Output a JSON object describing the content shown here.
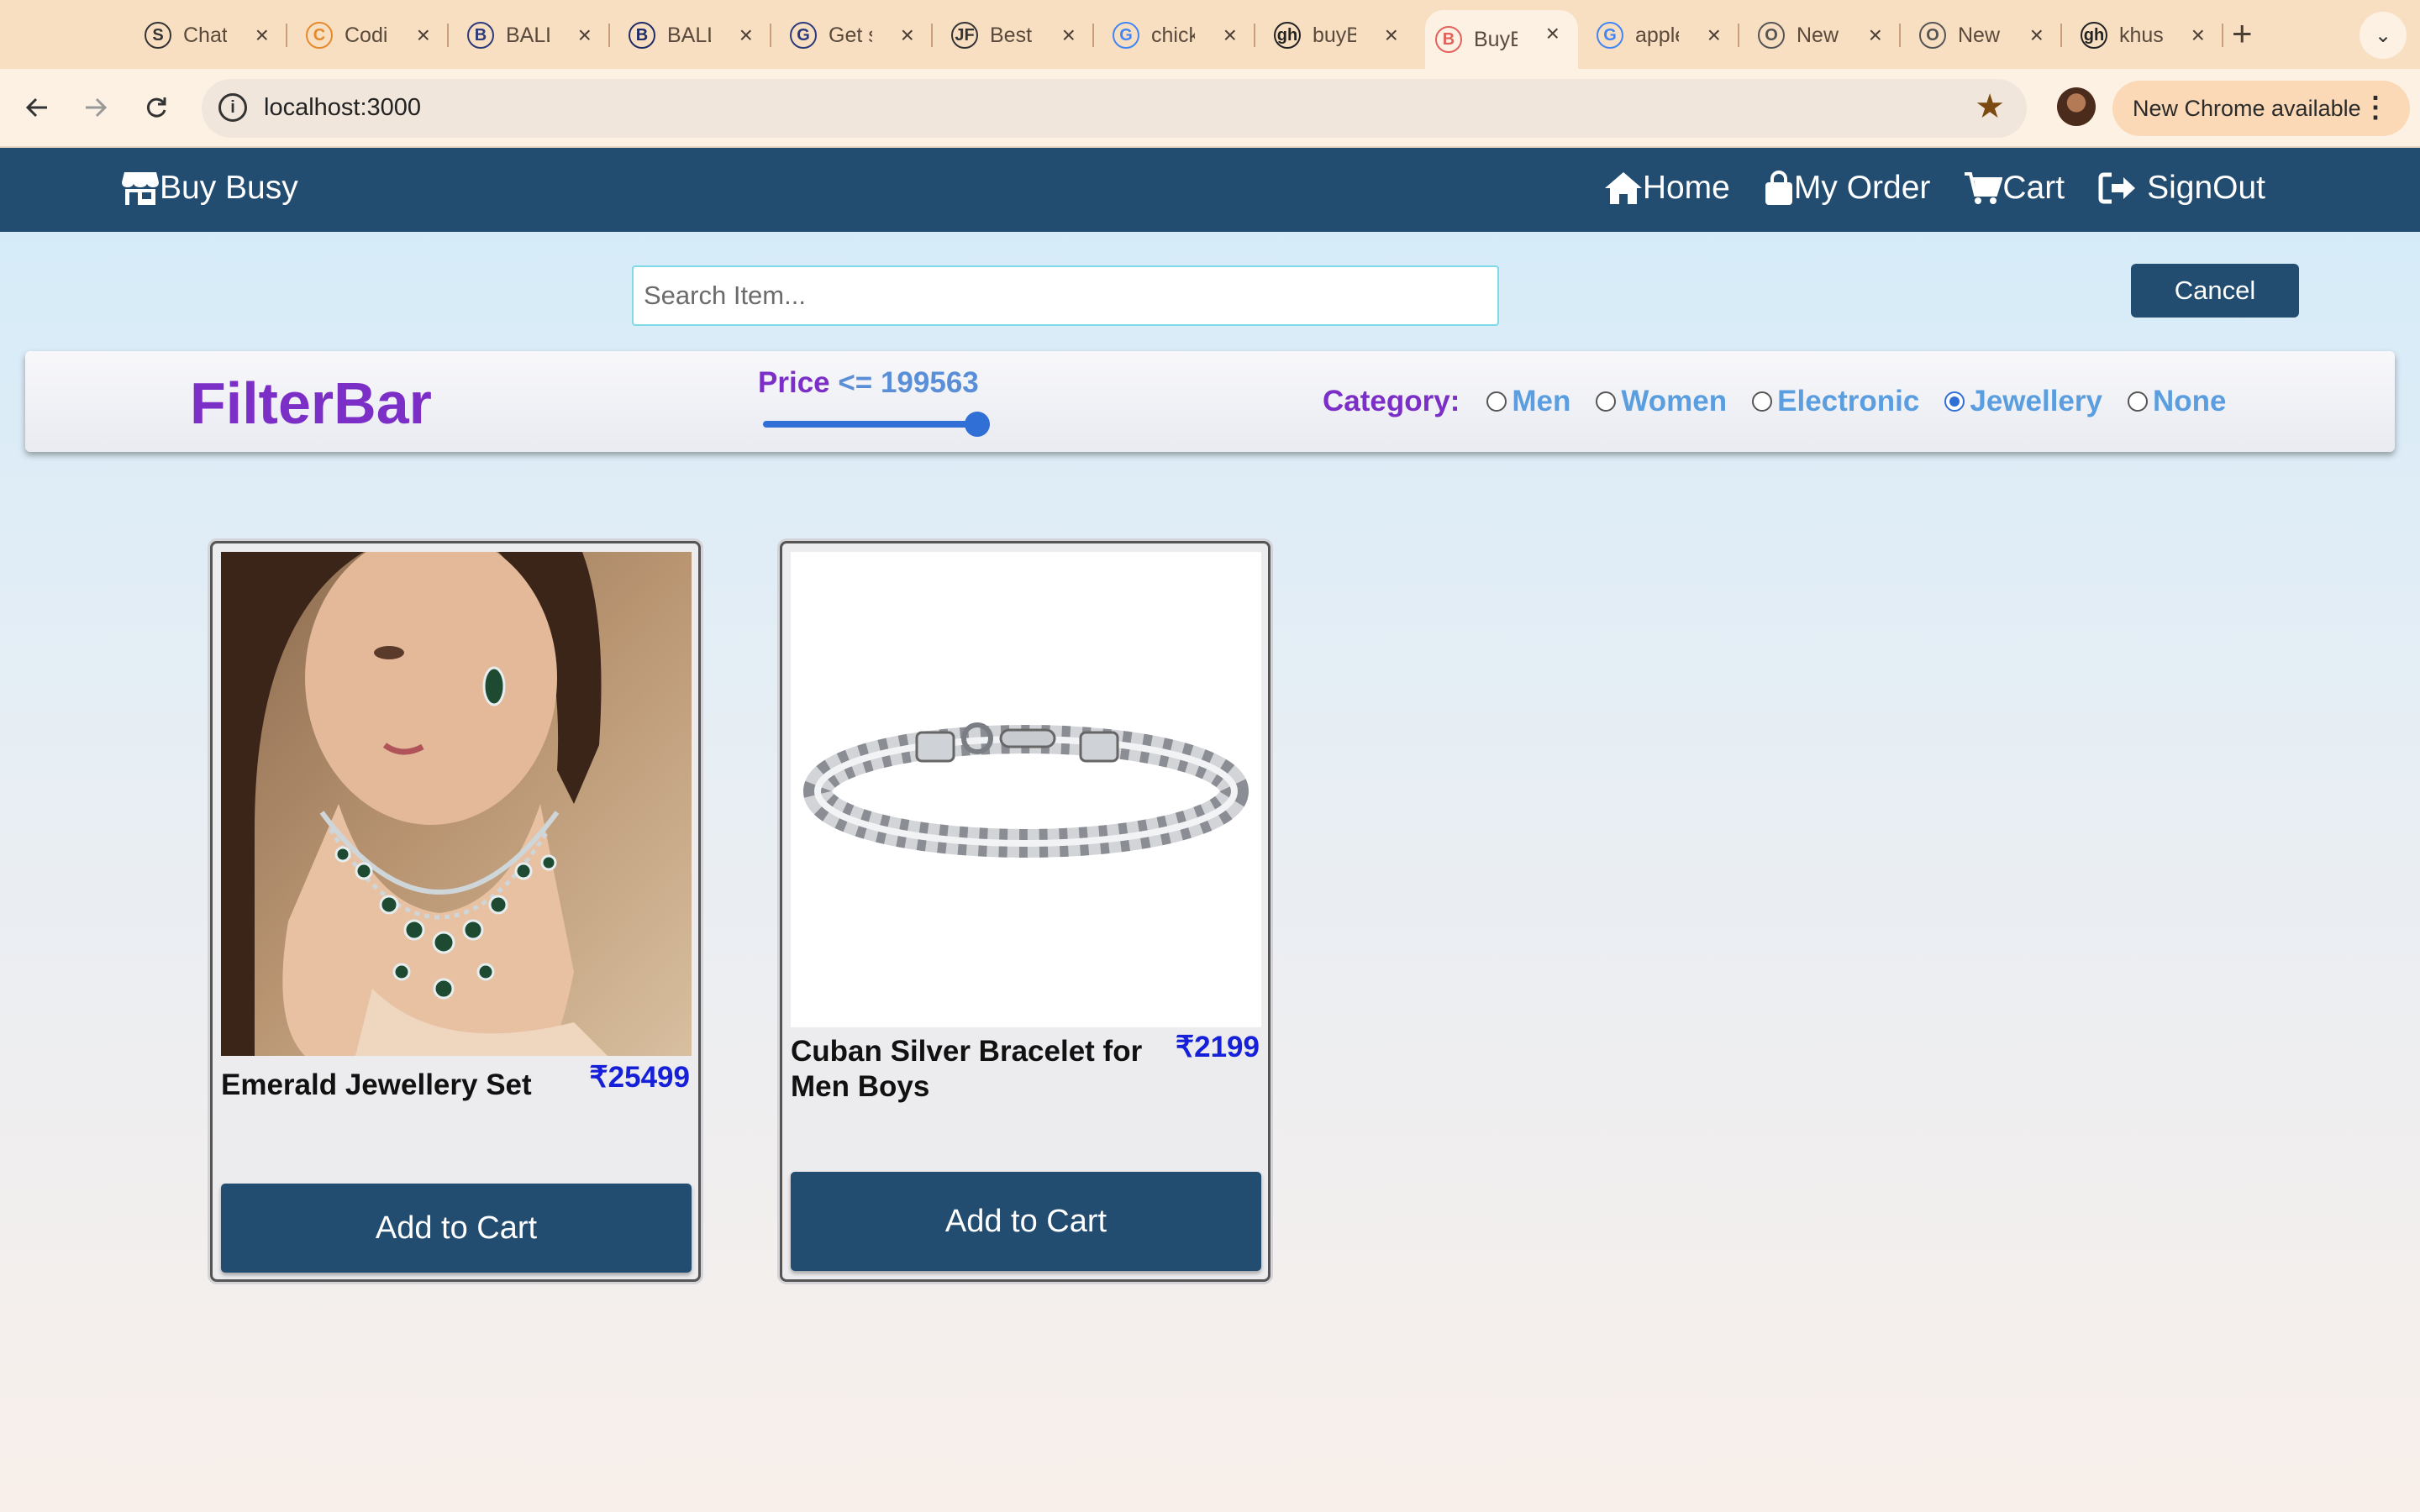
{
  "browser": {
    "tabs": [
      {
        "title": "ChatGPT",
        "fav": "S",
        "color": "#333333"
      },
      {
        "title": "Coding Ninjas",
        "fav": "C",
        "color": "#e58a2c"
      },
      {
        "title": "BALLERZZ",
        "fav": "B",
        "color": "#2a3a7a"
      },
      {
        "title": "BALLERZZ",
        "fav": "B",
        "color": "#1e2b66"
      },
      {
        "title": "Get started",
        "fav": "G",
        "color": "#2a3a7a"
      },
      {
        "title": "Best",
        "fav": "JF",
        "color": "#333333"
      },
      {
        "title": "chicken",
        "fav": "G",
        "color": "#4285f4"
      },
      {
        "title": "buyBusy",
        "fav": "gh",
        "color": "#222222"
      },
      {
        "title": "BuyBusy",
        "fav": "B",
        "color": "#e2615b"
      },
      {
        "title": "apple",
        "fav": "G",
        "color": "#4285f4"
      },
      {
        "title": "New Tab",
        "fav": "O",
        "color": "#555555"
      },
      {
        "title": "New Tab",
        "fav": "O",
        "color": "#555555"
      },
      {
        "title": "khushi",
        "fav": "gh",
        "color": "#222222"
      }
    ],
    "active_tab_index": 8,
    "new_tab_label": "+",
    "tab_menu_label": "⌄",
    "url": "localhost:3000",
    "update_label": "New Chrome available"
  },
  "nav": {
    "brand": "Buy Busy",
    "home": "Home",
    "orders": "My Order",
    "cart": "Cart",
    "signout": "SignOut"
  },
  "search": {
    "placeholder": "Search Item...",
    "cancel_label": "Cancel"
  },
  "filter": {
    "title": "FilterBar",
    "price_label": "Price",
    "price_value": "<= 199563",
    "slider_fraction": 1.0,
    "category_label": "Category:",
    "options": [
      "Men",
      "Women",
      "Electronic",
      "Jewellery",
      "None"
    ],
    "selected": "Jewellery"
  },
  "products": [
    {
      "name": "Emerald Jewellery Set",
      "price": "₹25499",
      "button": "Add to Cart"
    },
    {
      "name": "Cuban Silver Bracelet for Men Boys",
      "price": "₹2199",
      "button": "Add to Cart"
    }
  ],
  "colors": {
    "navbar": "#224c70",
    "accent_purple": "#7b2fc6",
    "price_blue": "#1620d9"
  }
}
